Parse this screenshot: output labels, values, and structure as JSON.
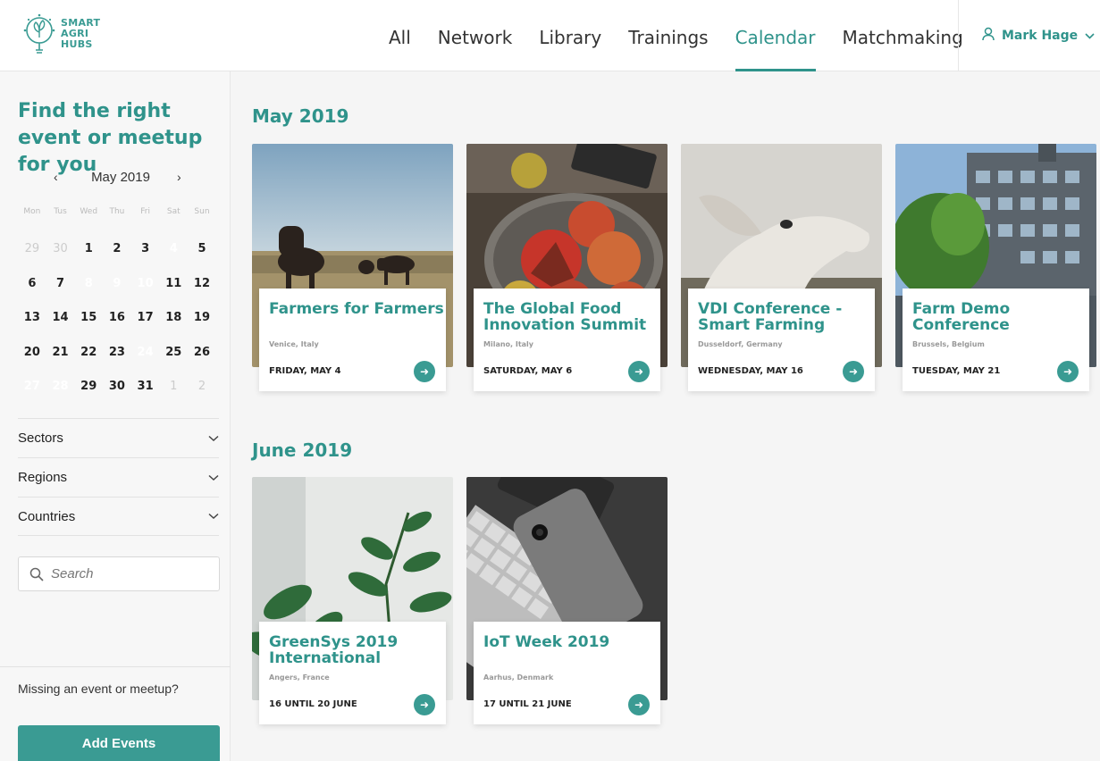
{
  "brand": {
    "line1": "SMART",
    "line2": "AGRI",
    "line3": "HUBS"
  },
  "nav": [
    {
      "label": "All",
      "active": false
    },
    {
      "label": "Network",
      "active": false
    },
    {
      "label": "Library",
      "active": false
    },
    {
      "label": "Trainings",
      "active": false
    },
    {
      "label": "Calendar",
      "active": true
    },
    {
      "label": "Matchmaking",
      "active": false
    }
  ],
  "user": {
    "name": "Mark Hage"
  },
  "sidebar": {
    "title": "Find the right event or meetup for you",
    "calendar": {
      "month": "May 2019",
      "prev": "‹",
      "next": "›",
      "weekdays": [
        "Mon",
        "Tus",
        "Wed",
        "Thu",
        "Fri",
        "Sat",
        "Sun"
      ],
      "days": [
        {
          "d": "29",
          "m": true
        },
        {
          "d": "30",
          "m": true
        },
        {
          "d": "1"
        },
        {
          "d": "2"
        },
        {
          "d": "3"
        },
        {
          "d": "4",
          "s": "single"
        },
        {
          "d": "5"
        },
        {
          "d": "6"
        },
        {
          "d": "7"
        },
        {
          "d": "8",
          "s": "start"
        },
        {
          "d": "9",
          "s": "mid"
        },
        {
          "d": "10",
          "s": "end"
        },
        {
          "d": "11"
        },
        {
          "d": "12"
        },
        {
          "d": "13"
        },
        {
          "d": "14"
        },
        {
          "d": "15"
        },
        {
          "d": "16"
        },
        {
          "d": "17"
        },
        {
          "d": "18"
        },
        {
          "d": "19"
        },
        {
          "d": "20"
        },
        {
          "d": "21"
        },
        {
          "d": "22"
        },
        {
          "d": "23"
        },
        {
          "d": "24",
          "s": "single"
        },
        {
          "d": "25"
        },
        {
          "d": "26"
        },
        {
          "d": "27",
          "s": "start"
        },
        {
          "d": "28",
          "s": "end"
        },
        {
          "d": "29"
        },
        {
          "d": "30"
        },
        {
          "d": "31"
        },
        {
          "d": "1",
          "m": true
        },
        {
          "d": "2",
          "m": true
        }
      ]
    },
    "filters": [
      "Sectors",
      "Regions",
      "Countries"
    ],
    "search_placeholder": "Search",
    "missing_text": "Missing an event or meetup?",
    "add_button": "Add Events"
  },
  "sections": [
    {
      "month": "May 2019",
      "events": [
        {
          "title": "Farmers for Farmers",
          "location": "Venice, Italy",
          "date": "FRIDAY, MAY 4",
          "image": "cows-field"
        },
        {
          "title": "The Global Food Innovation Summit",
          "location": "Milano, Italy",
          "date": "SATURDAY, MAY 6",
          "image": "apples-bowl"
        },
        {
          "title": "VDI Conference - Smart Farming",
          "location": "Dusseldorf, Germany",
          "date": "WEDNESDAY, MAY 16",
          "image": "sheep"
        },
        {
          "title": "Farm Demo Conference",
          "location": "Brussels, Belgium",
          "date": "TUESDAY, MAY 21",
          "image": "building-tree"
        }
      ]
    },
    {
      "month": "June 2019",
      "events": [
        {
          "title": "GreenSys 2019 International",
          "location": "Angers, France",
          "date": "16 UNTIL 20 JUNE",
          "image": "plant"
        },
        {
          "title": "IoT Week 2019",
          "location": "Aarhus, Denmark",
          "date": "17 UNTIL 21 JUNE",
          "image": "phone-keyboard"
        }
      ]
    }
  ],
  "colors": {
    "accent": "#2f938b",
    "button": "#3a9b93"
  }
}
